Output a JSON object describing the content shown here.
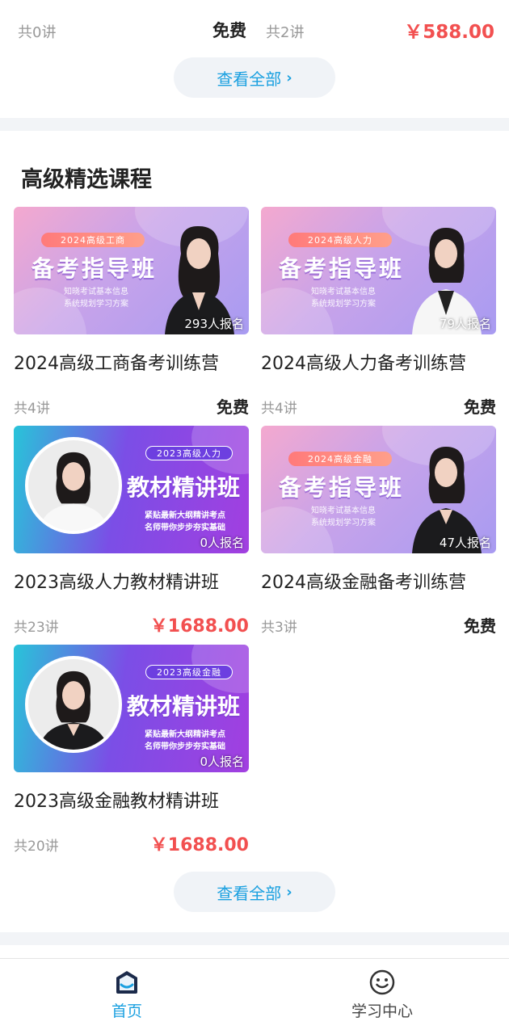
{
  "top_row": {
    "left_lectures": "共0讲",
    "left_price": "免费",
    "right_lectures": "共2讲",
    "right_price": "￥588.00"
  },
  "view_all_1": "查看全部",
  "section": {
    "title": "高级精选课程"
  },
  "courses": [
    {
      "tag": "2024高级工商",
      "headline": "备考指导班",
      "sub1": "知晓考试基本信息",
      "sub2": "系统规划学习方案",
      "enrolled": "293人报名",
      "title": "2024高级工商备考训练营",
      "lectures": "共4讲",
      "price": "免费"
    },
    {
      "tag": "2024高级人力",
      "headline": "备考指导班",
      "sub1": "知晓考试基本信息",
      "sub2": "系统规划学习方案",
      "enrolled": "79人报名",
      "title": "2024高级人力备考训练营",
      "lectures": "共4讲",
      "price": "免费"
    },
    {
      "tag": "2023高级人力",
      "headline": "教材精讲班",
      "sub1": "紧贴最新大纲精讲考点",
      "sub2": "名师带你步步夯实基础",
      "enrolled": "0人报名",
      "title": "2023高级人力教材精讲班",
      "lectures": "共23讲",
      "price": "￥1688.00"
    },
    {
      "tag": "2024高级金融",
      "headline": "备考指导班",
      "sub1": "知晓考试基本信息",
      "sub2": "系统规划学习方案",
      "enrolled": "47人报名",
      "title": "2024高级金融备考训练营",
      "lectures": "共3讲",
      "price": "免费"
    },
    {
      "tag": "2023高级金融",
      "headline": "教材精讲班",
      "sub1": "紧贴最新大纲精讲考点",
      "sub2": "名师带你步步夯实基础",
      "enrolled": "0人报名",
      "title": "2023高级金融教材精讲班",
      "lectures": "共20讲",
      "price": "￥1688.00"
    }
  ],
  "view_all_2": "查看全部",
  "tabbar": {
    "home": "首页",
    "study": "学习中心"
  },
  "colors": {
    "accent": "#1aa0e0",
    "price": "#f25050"
  }
}
